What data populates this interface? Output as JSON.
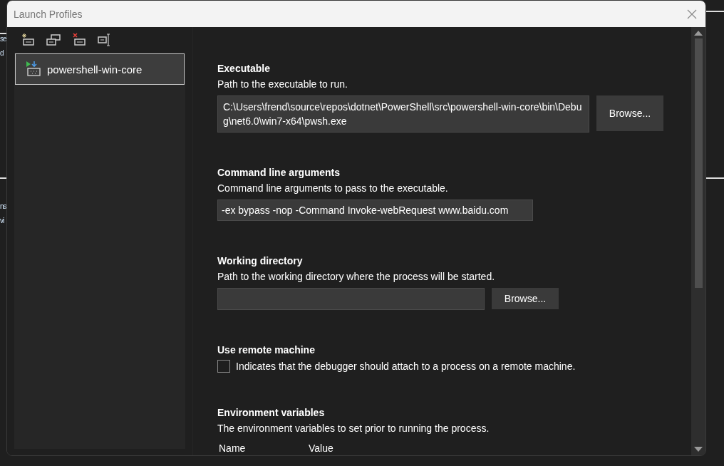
{
  "background_fragments": [
    "se",
    "d",
    "ns",
    "vi"
  ],
  "window": {
    "title": "Launch Profiles"
  },
  "toolbar": [
    {
      "kind": "new"
    },
    {
      "kind": "duplicate"
    },
    {
      "kind": "delete"
    },
    {
      "kind": "rename"
    }
  ],
  "profiles": [
    {
      "label": "powershell-win-core",
      "selected": true
    }
  ],
  "sections": [
    {
      "kind": "file",
      "heading": "Executable",
      "description": "Path to the executable to run.",
      "value": "C:\\Users\\frend\\source\\repos\\dotnet\\PowerShell\\src\\powershell-win-core\\bin\\Debug\\net6.0\\win7-x64\\pwsh.exe",
      "button": "Browse..."
    },
    {
      "kind": "text",
      "heading": "Command line arguments",
      "description": "Command line arguments to pass to the executable.",
      "value": "-ex bypass -nop -Command Invoke-webRequest www.baidu.com"
    },
    {
      "kind": "file",
      "heading": "Working directory",
      "description": "Path to the working directory where the process will be started.",
      "button": "Browse..."
    },
    {
      "kind": "checkbox",
      "heading": "Use remote machine",
      "description": "Indicates that the debugger should attach to a process on a remote machine.",
      "checked": false
    },
    {
      "kind": "table",
      "heading": "Environment variables",
      "description": "The environment variables to set prior to running the process.",
      "columns": [
        "Name",
        "Value"
      ]
    }
  ]
}
